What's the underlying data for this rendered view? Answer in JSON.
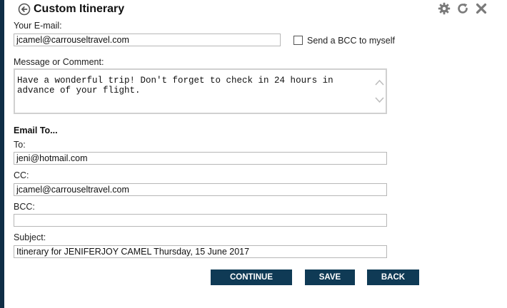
{
  "header": {
    "title": "Custom Itinerary"
  },
  "form": {
    "email_label": "Your E-mail:",
    "email_value": "jcamel@carrouseltravel.com",
    "bcc_self_label": "Send a BCC to myself",
    "bcc_self_checked": false,
    "message_label": "Message or Comment:",
    "message_value": "Have a wonderful trip! Don't forget to check in 24 hours in advance of your flight.",
    "email_to_heading": "Email To...",
    "to_label": "To:",
    "to_value": "jeni@hotmail.com",
    "cc_label": "CC:",
    "cc_value": "jcamel@carrouseltravel.com",
    "bcc_label": "BCC:",
    "bcc_value": "",
    "subject_label": "Subject:",
    "subject_value": "Itinerary for JENIFERJOY CAMEL Thursday, 15 June 2017"
  },
  "actions": {
    "continue_label": "CONTINUE",
    "save_label": "SAVE",
    "back_label": "BACK"
  },
  "colors": {
    "button_bg": "#0f3a55",
    "sidebar_edge": "#0f2e46"
  }
}
